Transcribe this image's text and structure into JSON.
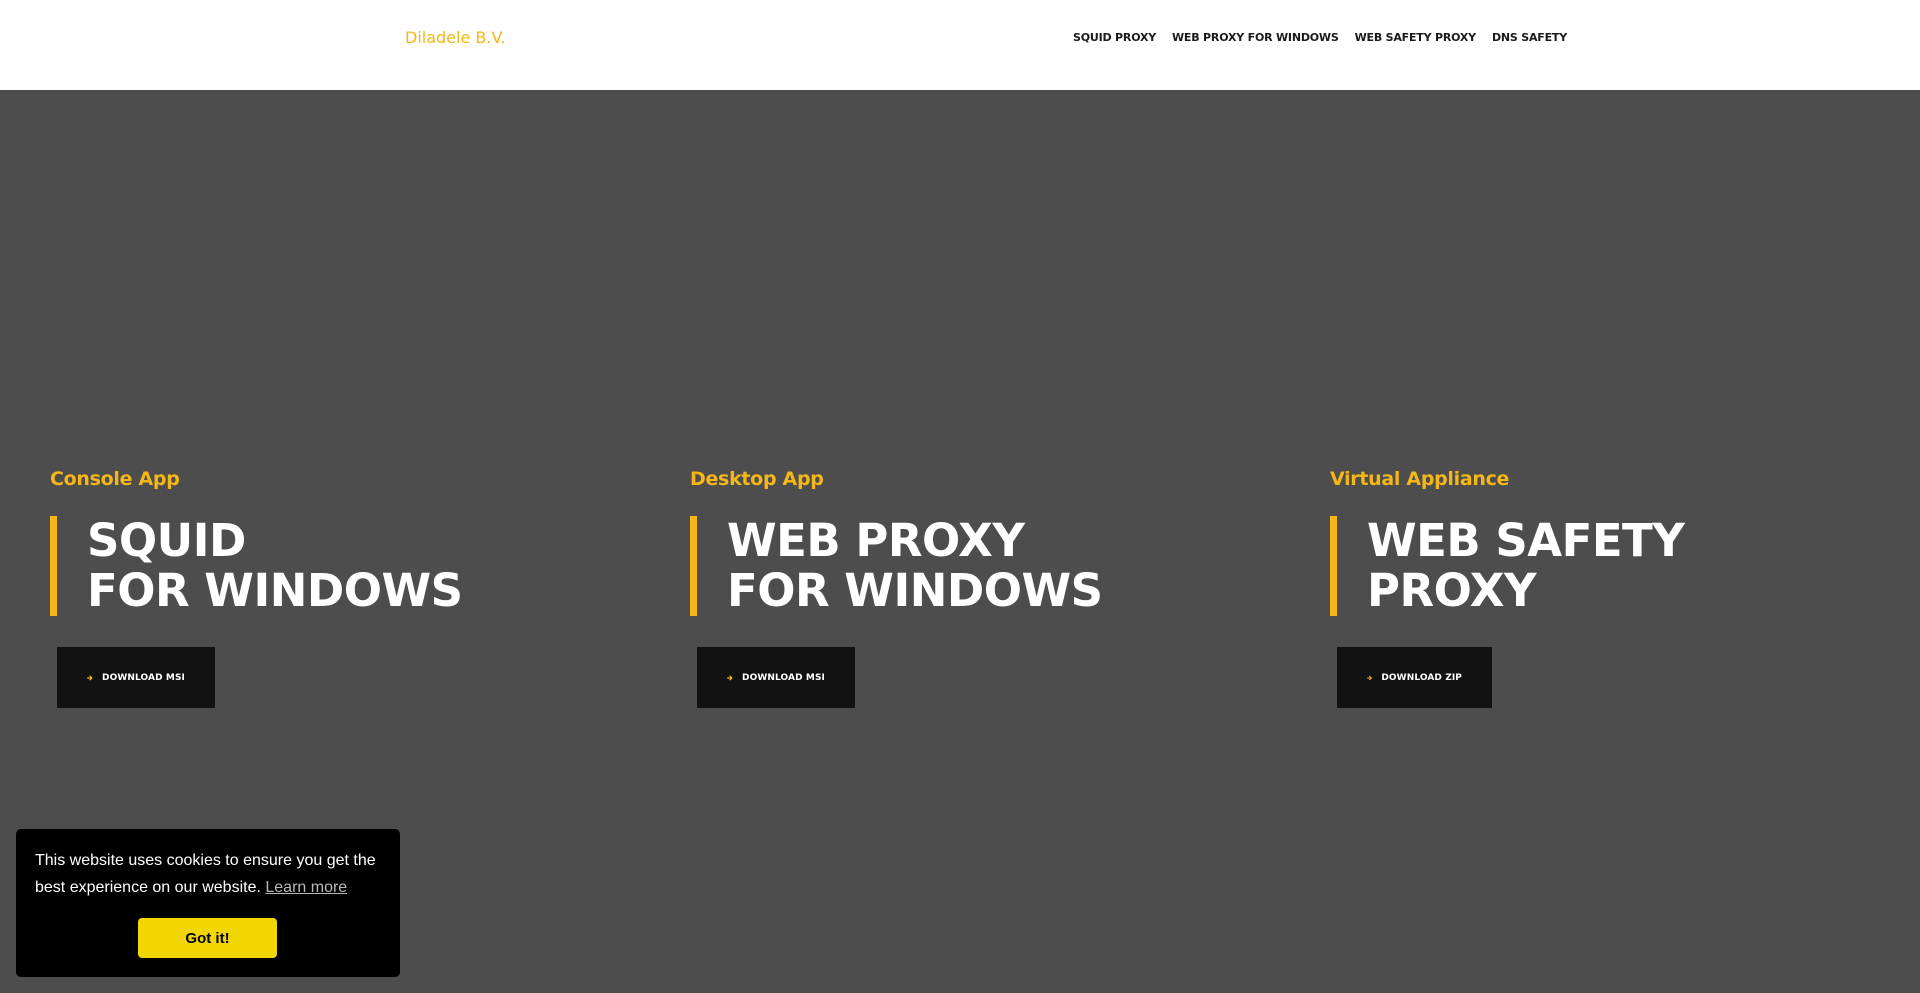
{
  "brand": "Diladele B.V.",
  "nav": [
    {
      "label": "SQUID PROXY"
    },
    {
      "label": "WEB PROXY FOR WINDOWS"
    },
    {
      "label": "WEB SAFETY PROXY"
    },
    {
      "label": "DNS SAFETY"
    }
  ],
  "products": [
    {
      "subtitle": "Console App",
      "title_line1": "SQUID",
      "title_line2": "FOR WINDOWS",
      "button": "DOWNLOAD MSI"
    },
    {
      "subtitle": "Desktop App",
      "title_line1": "WEB PROXY",
      "title_line2": "FOR WINDOWS",
      "button": "DOWNLOAD MSI"
    },
    {
      "subtitle": "Virtual Appliance",
      "title_line1": "WEB SAFETY",
      "title_line2": "PROXY",
      "button": "DOWNLOAD ZIP"
    }
  ],
  "cookie": {
    "message": "This website uses cookies to ensure you get the best experience on our website.",
    "learn_more": "Learn more",
    "accept": "Got it!"
  },
  "icons": {
    "button_icon": "arrow-right-icon"
  },
  "colors": {
    "accent": "#f5b617",
    "hero_bg": "#4d4d4d",
    "button_bg": "#121212",
    "cookie_bg": "#000000",
    "cookie_button": "#f1d600"
  }
}
